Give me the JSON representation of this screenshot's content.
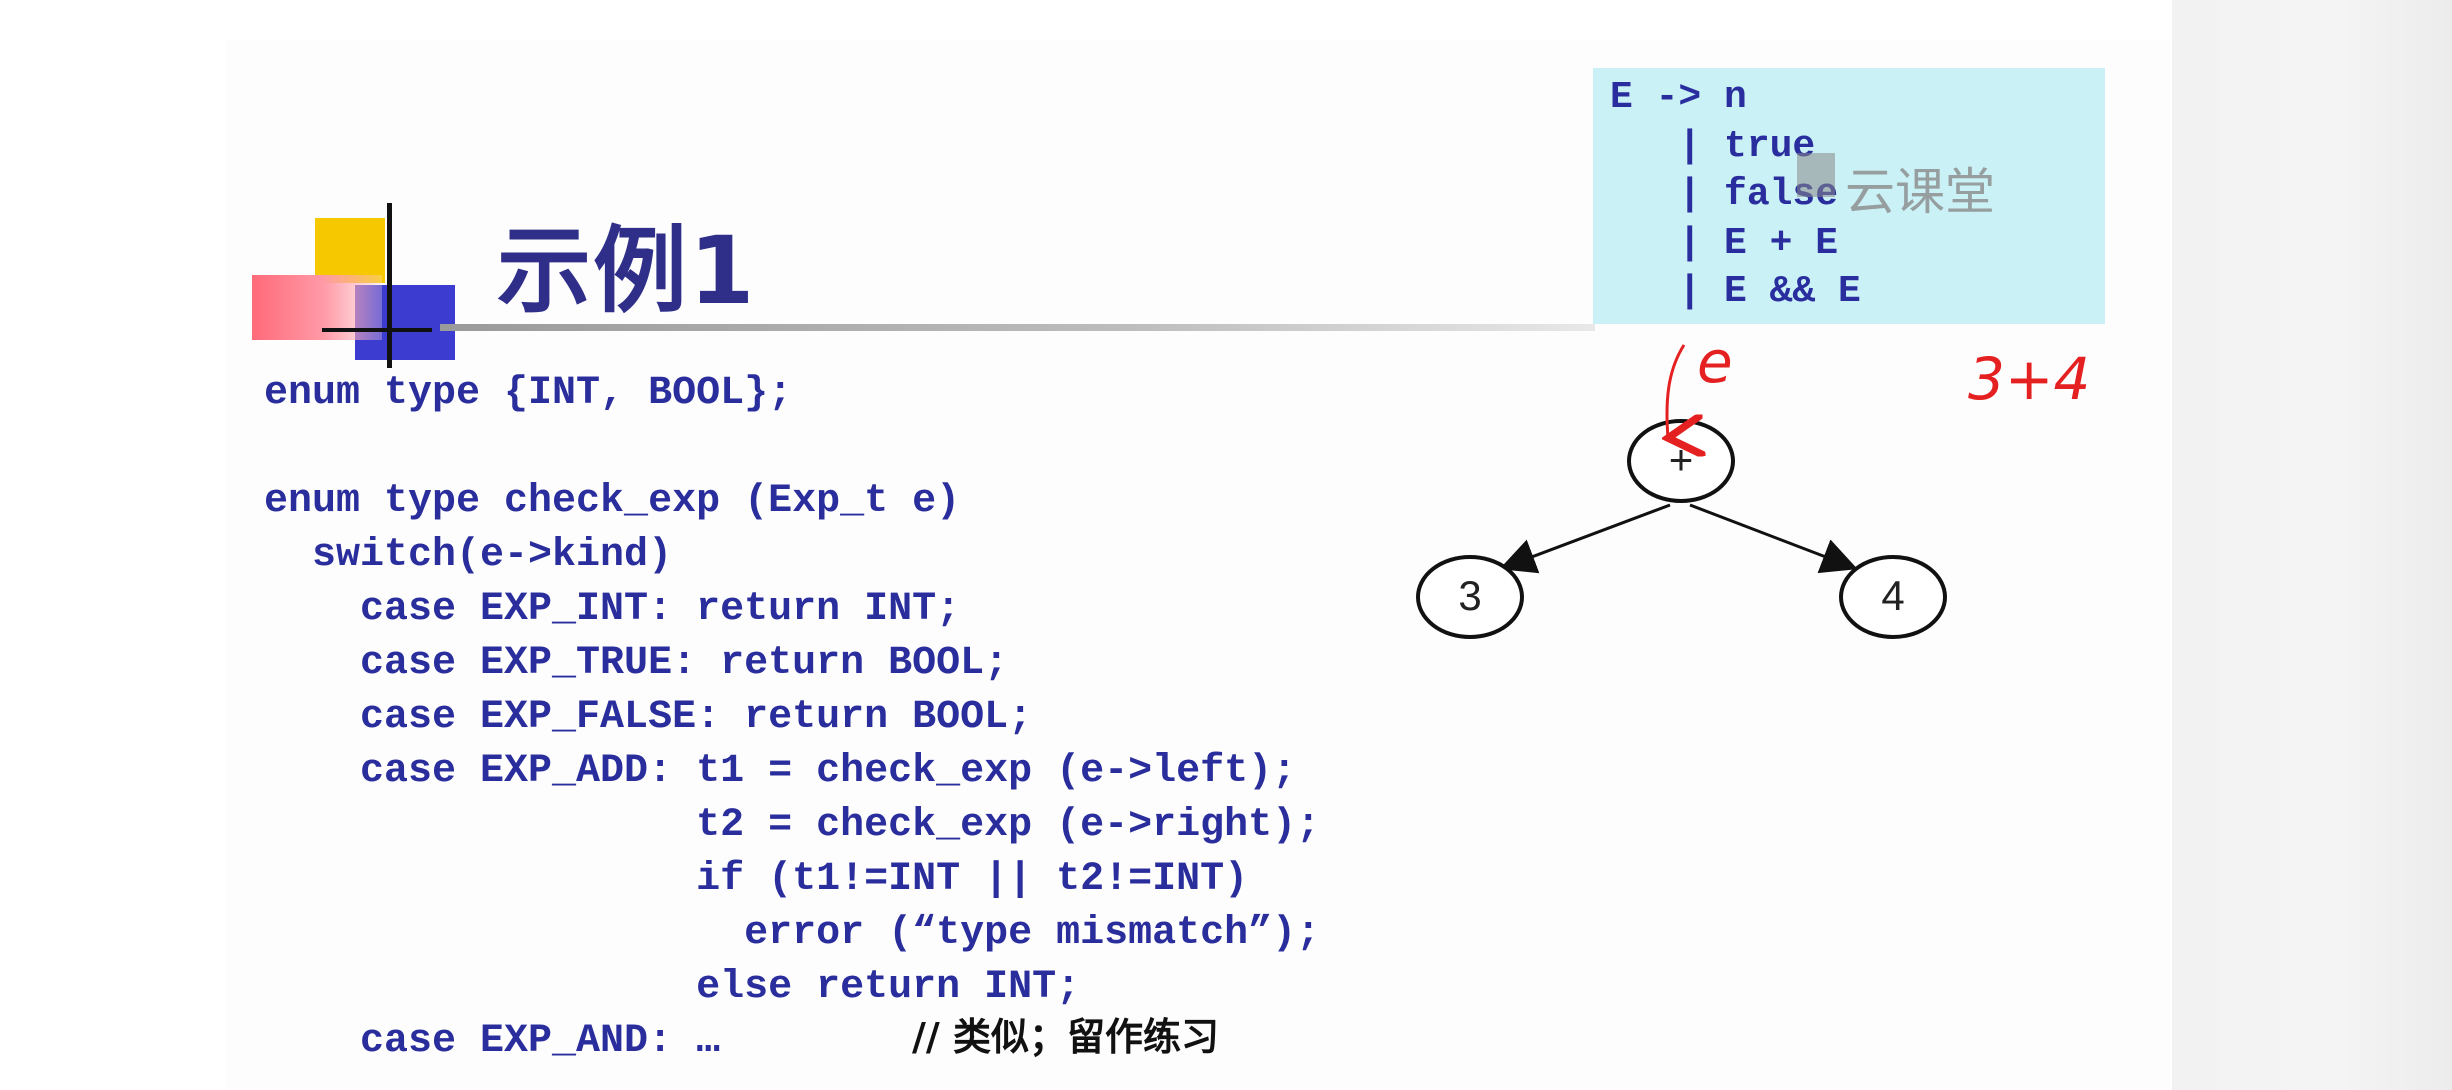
{
  "slide": {
    "title": "示例1"
  },
  "grammar": {
    "lines": [
      "E -> n",
      "   | true",
      "   | false",
      "   | E + E",
      "   | E && E"
    ]
  },
  "watermark": "云课堂",
  "code": {
    "lines": [
      "enum type {INT, BOOL};",
      "enum type check_exp (Exp_t e)",
      "  switch(e->kind)",
      "    case EXP_INT: return INT;",
      "    case EXP_TRUE: return BOOL;",
      "    case EXP_FALSE: return BOOL;",
      "    case EXP_ADD: t1 = check_exp (e->left);",
      "                  t2 = check_exp (e->right);",
      "                  if (t1!=INT || t2!=INT)",
      "                    error (“type mismatch”);",
      "                  else return INT;",
      "    case EXP_AND: … ",
      "// 类似；留作练习"
    ]
  },
  "tree": {
    "root": "+",
    "left": "3",
    "right": "4"
  },
  "annotations": {
    "e_mark": "e",
    "expr": "3+4"
  },
  "colors": {
    "code_blue": "#2a2e9c",
    "title_blue": "#2f2f8a",
    "grammar_bg": "#c9f1f6",
    "annotation_red": "#e42020"
  }
}
